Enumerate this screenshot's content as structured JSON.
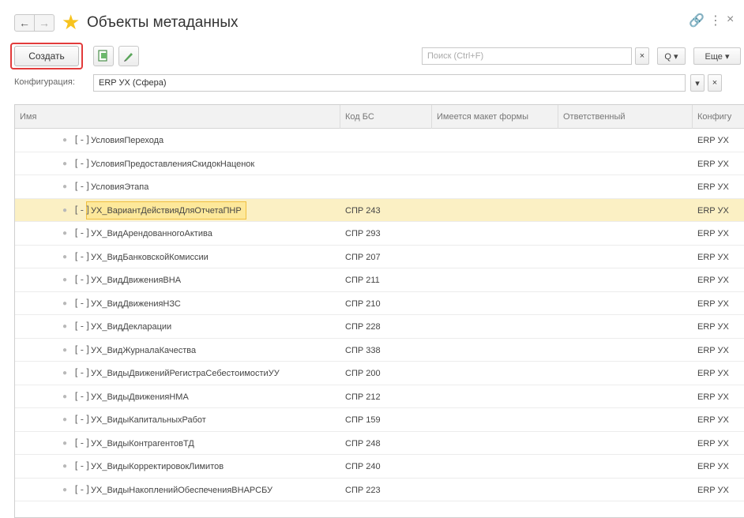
{
  "window": {
    "title": "Объекты метаданных",
    "back_icon": "←",
    "forward_icon": "→",
    "star_icon": "★",
    "link_icon": "🔗",
    "more_icon": "⋮",
    "close_icon": "×"
  },
  "toolbar": {
    "create_label": "Создать",
    "search_placeholder": "Поиск (Ctrl+F)",
    "search_clear": "×",
    "search_button": "Q ▾",
    "more_label": "Еще ▾"
  },
  "config": {
    "label": "Конфигурация:",
    "value": "ERP УХ (Сфера)",
    "dropdown": "▾",
    "clear": "×"
  },
  "table": {
    "columns": [
      "Имя",
      "Код БС",
      "Имеется макет формы",
      "Ответственный",
      "Конфигу"
    ],
    "rows": [
      {
        "name": "УсловияПерехода",
        "code": "",
        "conf": "ERP УХ",
        "selected": false
      },
      {
        "name": "УсловияПредоставленияСкидокНаценок",
        "code": "",
        "conf": "ERP УХ",
        "selected": false
      },
      {
        "name": "УсловияЭтапа",
        "code": "",
        "conf": "ERP УХ",
        "selected": false
      },
      {
        "name": "УХ_ВариантДействияДляОтчетаПНР",
        "code": "СПР 243",
        "conf": "ERP УХ",
        "selected": true
      },
      {
        "name": "УХ_ВидАрендованногоАктива",
        "code": "СПР 293",
        "conf": "ERP УХ",
        "selected": false
      },
      {
        "name": "УХ_ВидБанковскойКомиссии",
        "code": "СПР 207",
        "conf": "ERP УХ",
        "selected": false
      },
      {
        "name": "УХ_ВидДвиженияВНА",
        "code": "СПР 211",
        "conf": "ERP УХ",
        "selected": false
      },
      {
        "name": "УХ_ВидДвиженияНЗС",
        "code": "СПР 210",
        "conf": "ERP УХ",
        "selected": false
      },
      {
        "name": "УХ_ВидДекларации",
        "code": "СПР 228",
        "conf": "ERP УХ",
        "selected": false
      },
      {
        "name": "УХ_ВидЖурналаКачества",
        "code": "СПР 338",
        "conf": "ERP УХ",
        "selected": false
      },
      {
        "name": "УХ_ВидыДвиженийРегистраСебестоимостиУУ",
        "code": "СПР 200",
        "conf": "ERP УХ",
        "selected": false
      },
      {
        "name": "УХ_ВидыДвиженияНМА",
        "code": "СПР 212",
        "conf": "ERP УХ",
        "selected": false
      },
      {
        "name": "УХ_ВидыКапитальныхРабот",
        "code": "СПР 159",
        "conf": "ERP УХ",
        "selected": false
      },
      {
        "name": "УХ_ВидыКонтрагентовТД",
        "code": "СПР 248",
        "conf": "ERP УХ",
        "selected": false
      },
      {
        "name": "УХ_ВидыКорректировокЛимитов",
        "code": "СПР 240",
        "conf": "ERP УХ",
        "selected": false
      },
      {
        "name": "УХ_ВидыНакопленийОбеспеченияВНАРСБУ",
        "code": "СПР 223",
        "conf": "ERP УХ",
        "selected": false
      }
    ]
  },
  "colors": {
    "accent_star": "#f7c31e",
    "create_frame": "#e23b3b",
    "selected_row": "#fbf0c4"
  }
}
